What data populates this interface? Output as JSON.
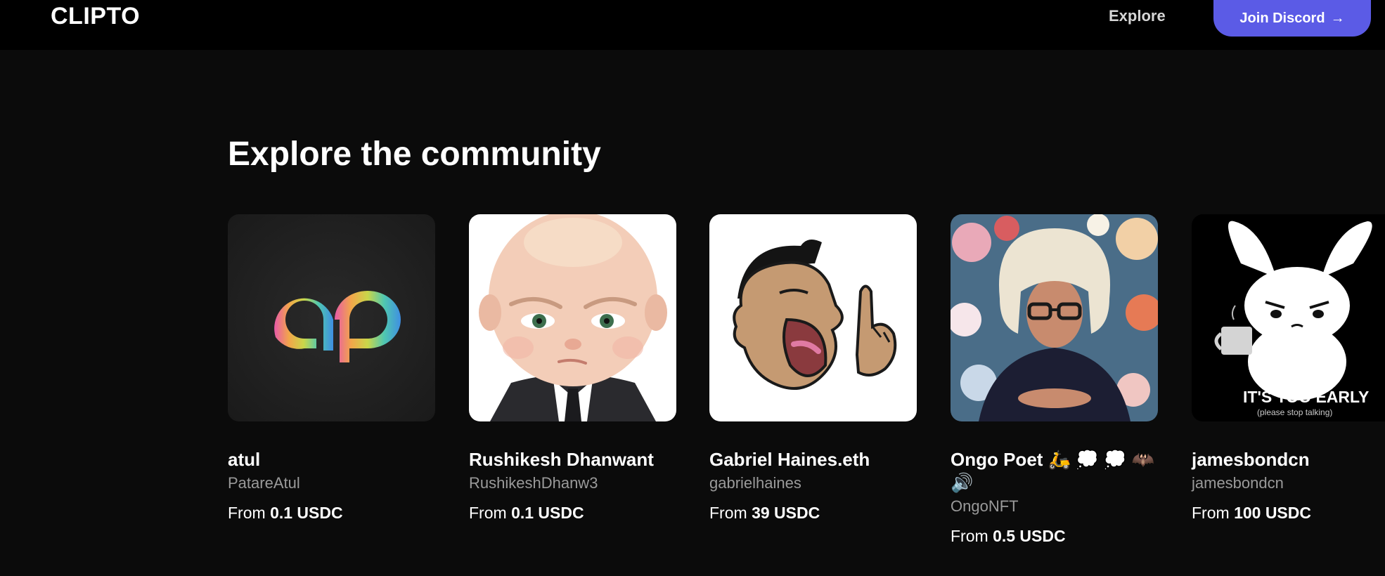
{
  "header": {
    "logo": "CLIPTO",
    "nav_explore": "Explore",
    "discord_label": "Join Discord",
    "discord_arrow": "→",
    "accent_color": "#5b5be6"
  },
  "main": {
    "title": "Explore the community",
    "price_prefix": "From",
    "cards": [
      {
        "name": "atul",
        "handle": "PatareAtul",
        "price": "0.1 USDC",
        "avatar": "ap-logo"
      },
      {
        "name": "Rushikesh Dhanwant",
        "handle": "RushikeshDhanw3",
        "price": "0.1 USDC",
        "avatar": "boss-baby-portrait"
      },
      {
        "name": "Gabriel Haines.eth",
        "handle": "gabrielhaines",
        "price": "39 USDC",
        "avatar": "shouting-cartoon"
      },
      {
        "name": "Ongo Poet 🛵 💭 💭 🦇 🔊",
        "handle": "OngoNFT",
        "price": "0.5 USDC",
        "avatar": "white-wig-portrait"
      },
      {
        "name": "jamesbondcn",
        "handle": "jamesbondcn",
        "price": "100 USDC",
        "avatar": "bunny-its-too-early"
      }
    ],
    "bunny_caption": "IT'S TOO EARLY",
    "bunny_subcaption": "(please stop talking)"
  }
}
